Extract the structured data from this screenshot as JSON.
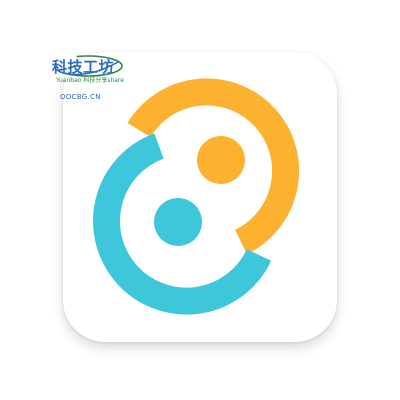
{
  "watermark": {
    "title": "科技工坊",
    "subtitle": "Yuanbao 科技分享share",
    "domain": "OOCBG.CN"
  },
  "colors": {
    "orange": "#FCB22E",
    "cyan": "#3EC6DA",
    "tile": "#FFFFFF",
    "watermark_blue": "#2A6BC4",
    "watermark_green": "#2E8A4A"
  },
  "icons": [
    "app-logo-icon",
    "watermark-logo-icon"
  ]
}
